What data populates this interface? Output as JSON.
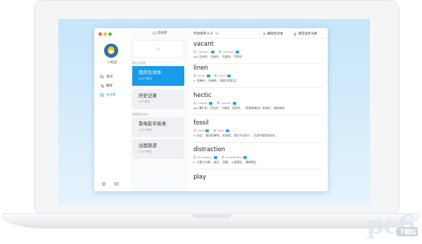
{
  "app": {
    "user": {
      "name": "小松鼠"
    },
    "nav": [
      {
        "label": "查词",
        "icon": "search-icon"
      },
      {
        "label": "翻译",
        "icon": "translate-icon"
      },
      {
        "label": "生词本",
        "icon": "notebook-icon",
        "active": true
      }
    ],
    "nav_bottom": [
      "settings-icon",
      "theme-icon"
    ]
  },
  "lists": {
    "sync_label": "云同步",
    "add_label": "+",
    "default_group": "默认生词本",
    "created_group": "创建的生词本",
    "default_cards": [
      {
        "title": "我的生词本",
        "count": "209个单词",
        "active": true
      },
      {
        "title": "历史记录",
        "count": "39个单词"
      }
    ],
    "created_cards": [
      {
        "title": "看电影学英语",
        "count": "100个单词"
      },
      {
        "title": "出国旅游",
        "count": "230个单词"
      }
    ]
  },
  "words": {
    "sort_label": "字母排序 A-Z",
    "delete_label": "删除生词本",
    "clear_label": "清空该生词本",
    "entries": [
      {
        "word": "vacant",
        "uk": "英 /'veikant/",
        "us": "美 /'veikant/",
        "def": "adj. 空闲的；  空缺的；  空虚的；  茫然的"
      },
      {
        "word": "linen",
        "uk": "英 /'linin/",
        "us": "美 /'linin/",
        "def": "n. 亚麻布，  亚麻线；  家庭日用织品；"
      },
      {
        "word": "hectic",
        "uk": "英 /'hektik/",
        "us": "美 /'hektik/",
        "def": "adj. 繁忙的，忙乱的；  兴奋的，狂热的；  《医患病情况》发烧的；  患热病的"
      },
      {
        "word": "fossil",
        "uk": "英 /'fosl/",
        "us": "美 /'fasl/",
        "def": "n. 化石；  僵化的事物；  老顽固，  食古不化的人；  日语中操用的旧词"
      },
      {
        "word": "distraction",
        "uk": "英 /di'strækfn/",
        "us": "美 /di'strækfən/",
        "def": "n. 注意力分散；  娱乐，  消遣；  心烦意乱；  精神错乱"
      },
      {
        "word": "play",
        "uk": "",
        "us": "",
        "def": ""
      }
    ]
  },
  "watermark": {
    "text": "pc6",
    "tag": "下载站"
  },
  "colors": {
    "accent": "#1a9bea",
    "screen": "#c7e5fa"
  }
}
